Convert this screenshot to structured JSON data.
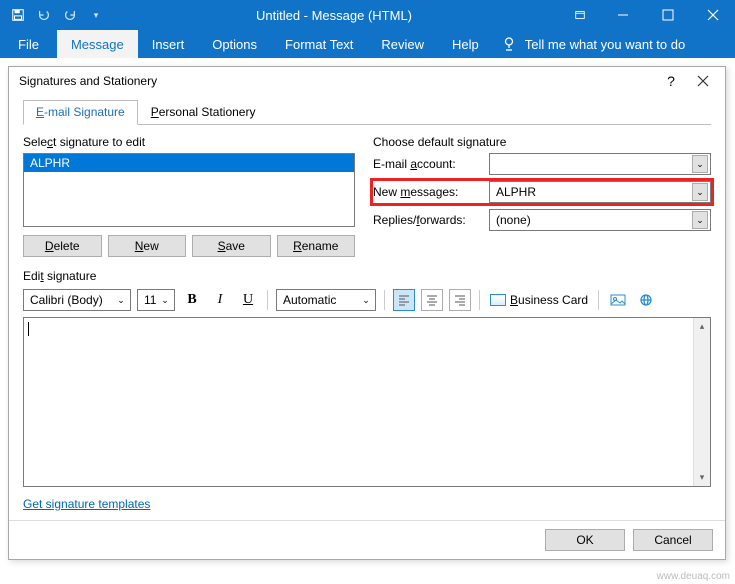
{
  "app": {
    "title": "Untitled  -  Message (HTML)"
  },
  "ribbon": {
    "file": "File",
    "message": "Message",
    "insert": "Insert",
    "options": "Options",
    "format": "Format Text",
    "review": "Review",
    "help": "Help",
    "tellme": "Tell me what you want to do"
  },
  "dialog": {
    "title": "Signatures and Stationery",
    "tab_email": "E-mail Signature",
    "tab_stationery": "Personal Stationery",
    "select_label": "Select signature to edit",
    "signature_items": [
      "ALPHR"
    ],
    "btn_delete": "Delete",
    "btn_new": "New",
    "btn_save": "Save",
    "btn_rename": "Rename",
    "choose_label": "Choose default signature",
    "email_account_label": "E-mail account:",
    "email_account_value": "",
    "new_messages_label": "New messages:",
    "new_messages_value": "ALPHR",
    "replies_label": "Replies/forwards:",
    "replies_value": "(none)",
    "edit_label": "Edit signature",
    "font_name": "Calibri (Body)",
    "font_size": "11",
    "color_mode": "Automatic",
    "business_card": "Business Card",
    "templates_link": "Get signature templates",
    "ok": "OK",
    "cancel": "Cancel"
  },
  "watermark": "www.deuaq.com"
}
